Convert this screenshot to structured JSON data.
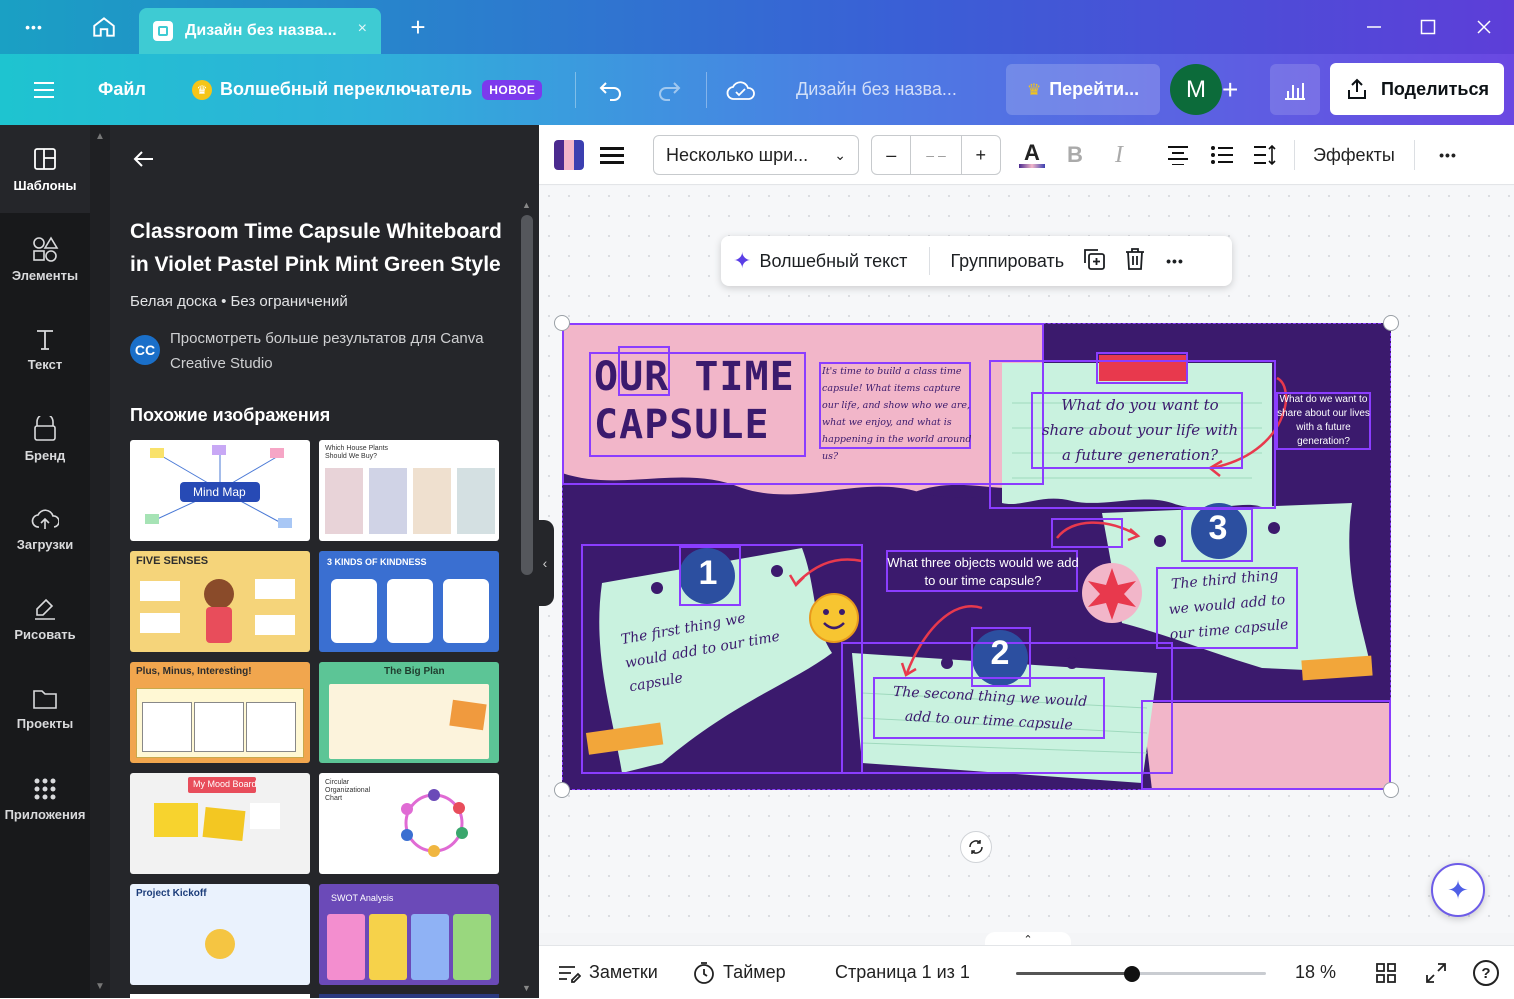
{
  "titlebar": {
    "tab_title": "Дизайн без назва...",
    "tab_close": "×",
    "new_tab": "+",
    "menu_dots": "•••"
  },
  "menubar": {
    "file": "Файл",
    "magic_switch": "Волшебный переключатель",
    "new_badge": "НОВОЕ",
    "design_title": "Дизайн без назва...",
    "upgrade": "Перейти...",
    "avatar_letter": "M",
    "share": "Поделиться"
  },
  "rail": {
    "items": [
      {
        "label": "Шаблоны"
      },
      {
        "label": "Элементы"
      },
      {
        "label": "Текст"
      },
      {
        "label": "Бренд"
      },
      {
        "label": "Загрузки"
      },
      {
        "label": "Рисовать"
      },
      {
        "label": "Проекты"
      },
      {
        "label": "Приложения"
      }
    ]
  },
  "panel": {
    "title": "Classroom Time Capsule Whiteboard in Violet Pastel Pink Mint Green Style",
    "subtitle": "Белая доска • Без ограничений",
    "creator_initials": "CC",
    "creator_text": "Просмотреть больше результатов для Canva Creative Studio",
    "similar_heading": "Похожие изображения",
    "thumbs": [
      {
        "label": "Mind Map"
      },
      {
        "label": "Which House Plants Should We Buy?"
      },
      {
        "label": "FIVE SENSES"
      },
      {
        "label": "3 KINDS OF KINDNESS"
      },
      {
        "label": "Plus, Minus, Interesting!"
      },
      {
        "label": "The Big Plan"
      },
      {
        "label": "My Mood Board"
      },
      {
        "label": "Circular Organizational Chart"
      },
      {
        "label": "Project Kickoff"
      },
      {
        "label": "SWOT Analysis"
      }
    ]
  },
  "toolbar": {
    "font_select": "Несколько шри...",
    "minus": "–",
    "size_value": "– –",
    "plus": "+",
    "bold": "B",
    "italic": "I",
    "effects": "Эффекты",
    "more": "•••"
  },
  "floatbar": {
    "magic_text": "Волшебный текст",
    "group": "Группировать",
    "more": "•••"
  },
  "design": {
    "title_line1": "OUR TIME",
    "title_line2": "CAPSULE",
    "intro": "It's time to build a class time capsule! What items capture our life, and show who we are, what we enjoy, and what is happening in the world around us?",
    "q_top": "What do you want to share about your life with a future generation?",
    "q_side": "What do we want to share about our lives with a future generation?",
    "q_mid": "What three objects would we add to our time capsule?",
    "n1": "1",
    "n2": "2",
    "n3": "3",
    "t1": "The first thing we would add to our time capsule",
    "t2": "The second thing we would add to our time capsule",
    "t3": "The third thing we would add to our time capsule"
  },
  "bottombar": {
    "notes": "Заметки",
    "timer": "Таймер",
    "page": "Страница 1 из 1",
    "zoom": "18 %",
    "zoom_fraction": 0.18,
    "help": "?"
  },
  "colors": {
    "purple_bg": "#3b1a6d",
    "pink": "#f2b6c9",
    "mint": "#c9f2df",
    "navy_circle": "#2c4fa0",
    "selection": "#8b3dff"
  }
}
